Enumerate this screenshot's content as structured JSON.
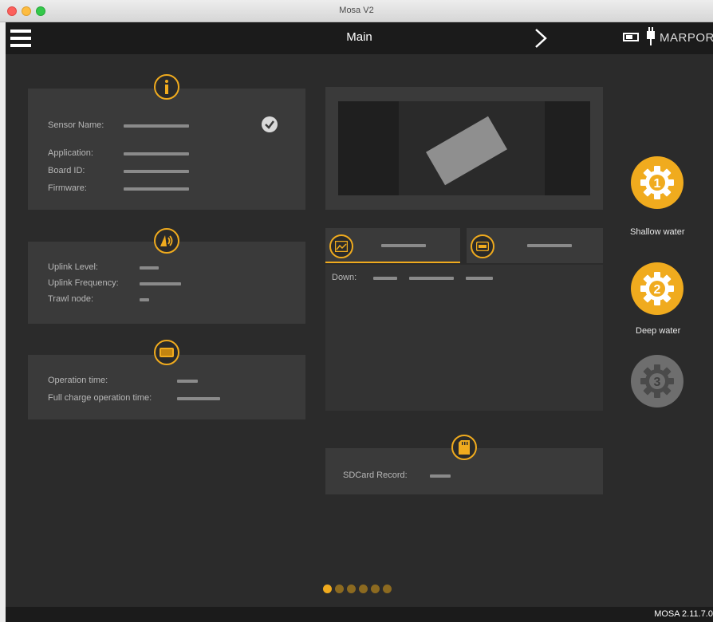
{
  "window": {
    "title": "Mosa V2"
  },
  "topbar": {
    "title": "Main",
    "brand": "MARPORT"
  },
  "info_panel": {
    "icon": "info-icon",
    "fields": [
      {
        "label": "Sensor Name:"
      },
      {
        "label": "Application:"
      },
      {
        "label": "Board ID:"
      },
      {
        "label": "Firmware:"
      }
    ]
  },
  "uplink_panel": {
    "icon": "uplink-icon",
    "fields": [
      {
        "label": "Uplink Level:"
      },
      {
        "label": "Uplink Frequency:"
      },
      {
        "label": "Trawl node:"
      }
    ]
  },
  "battery_panel": {
    "icon": "battery-icon",
    "fields": [
      {
        "label": "Operation time:"
      },
      {
        "label": "Full charge operation time:"
      }
    ]
  },
  "data_panel": {
    "tabs": [
      {
        "icon": "chart-icon"
      },
      {
        "icon": "gauge-icon"
      }
    ],
    "down_label": "Down:"
  },
  "sdcard_panel": {
    "icon": "sdcard-icon",
    "label": "SDCard Record:"
  },
  "profiles": [
    {
      "number": "1",
      "label": "Shallow water",
      "active": true,
      "color": "#f0ab1e"
    },
    {
      "number": "2",
      "label": "Deep water",
      "active": true,
      "color": "#f0ab1e"
    },
    {
      "number": "3",
      "label": "",
      "active": false,
      "color": "#6e6e6e"
    }
  ],
  "pager": {
    "pages": 6,
    "current": 1
  },
  "status": {
    "version": "MOSA 2.11.7.0"
  },
  "colors": {
    "accent": "#f0ab1e",
    "background": "#2b2b2b",
    "panel": "#3a3a3a"
  }
}
